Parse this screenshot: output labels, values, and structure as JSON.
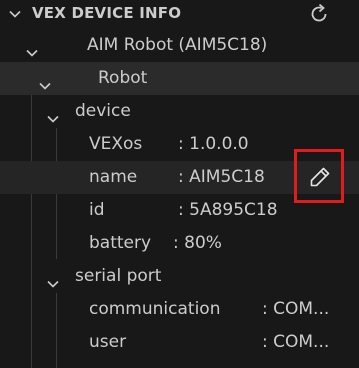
{
  "panel": {
    "title": "VEX DEVICE INFO",
    "refresh_icon": "refresh-icon"
  },
  "tree": {
    "robot_device": "AIM Robot (AIM5C18)",
    "robot": "Robot",
    "device": {
      "label": "device",
      "vexos": {
        "key": "VEXos",
        "value": ": 1.0.0.0"
      },
      "name": {
        "key": "name",
        "value": ": AIM5C18"
      },
      "id": {
        "key": "id",
        "value": ": 5A895C18"
      },
      "battery": {
        "key": "battery",
        "value": ": 80%"
      }
    },
    "serial_port": {
      "label": "serial port",
      "communication": {
        "key": "communication",
        "value": ": COM..."
      },
      "user": {
        "key": "user",
        "value": ": COM..."
      }
    }
  },
  "actions": {
    "edit_icon": "pencil-icon"
  },
  "colors": {
    "background": "#181818",
    "selected_row": "#2b2b2b",
    "text": "#cccccc",
    "highlight_box": "#e21b1b"
  }
}
